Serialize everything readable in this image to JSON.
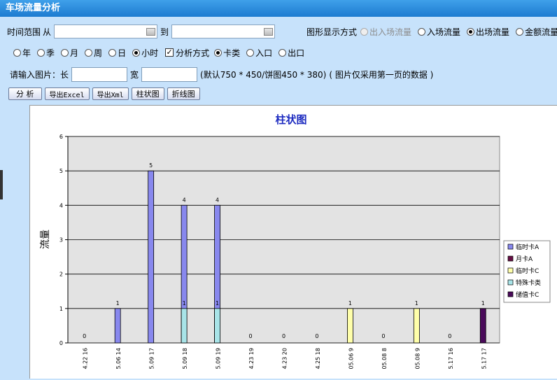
{
  "titlebar": {
    "title": "车场流量分析"
  },
  "filters": {
    "time_range_label": "时间范围",
    "from_label": "从",
    "to_label": "到",
    "display_mode_label": "图形显示方式",
    "display_modes": [
      "出入场流量",
      "入场流量",
      "出场流量",
      "金额流量"
    ],
    "display_selected": 2,
    "periods": [
      "年",
      "季",
      "月",
      "周",
      "日",
      "小时"
    ],
    "period_selected": 5,
    "analysis_label": "分析方式",
    "analysis_checked": true,
    "analysis_modes": [
      "卡类",
      "入口",
      "出口"
    ],
    "analysis_selected": 0,
    "size_label": "请输入图片：长",
    "width_label": "宽",
    "hint": "(默认750 * 450/饼图450 * 380)",
    "note": "( 图片仅采用第一页的数据 )"
  },
  "toolbar": {
    "analyze": "分 析",
    "export_excel": "导出Excel",
    "export_xml": "导出Xml",
    "bar_chart": "柱状图",
    "line_chart": "折线图"
  },
  "chart_data": {
    "type": "bar",
    "title": "柱状图",
    "ylabel": "流量",
    "ylim": [
      0,
      6
    ],
    "yticks": [
      0,
      1,
      2,
      3,
      4,
      5,
      6
    ],
    "grid": true,
    "legend": "right",
    "categories": [
      "4.22 16",
      "5.06 14",
      "5.09 17",
      "5.09 18",
      "5.09 19",
      "4.23 19",
      "4.23 20",
      "4.25 18",
      "05.06 9",
      "05.08 8",
      "05.08 9",
      "5.17 16",
      "5.17 17"
    ],
    "series": [
      {
        "name": "临时卡A",
        "color": "#8888ee",
        "values": [
          0,
          1,
          5,
          4,
          4,
          0,
          0,
          0,
          0,
          0,
          0,
          0,
          0
        ]
      },
      {
        "name": "月卡A",
        "color": "#660e44",
        "values": [
          0,
          0,
          0,
          0,
          0,
          0,
          0,
          0,
          0,
          0,
          0,
          0,
          0
        ]
      },
      {
        "name": "临时卡C",
        "color": "#ffffaa",
        "values": [
          0,
          0,
          0,
          0,
          0,
          0,
          0,
          0,
          1,
          0,
          1,
          0,
          0
        ]
      },
      {
        "name": "特殊卡类",
        "color": "#a8e4e8",
        "values": [
          0,
          0,
          0,
          1,
          1,
          0,
          0,
          0,
          0,
          0,
          0,
          0,
          0
        ]
      },
      {
        "name": "储值卡C",
        "color": "#4a0a5a",
        "values": [
          0,
          0,
          0,
          0,
          0,
          0,
          0,
          0,
          0,
          0,
          0,
          0,
          1
        ]
      }
    ],
    "zero_labels": [
      0,
      5,
      6,
      7,
      9,
      11
    ]
  }
}
